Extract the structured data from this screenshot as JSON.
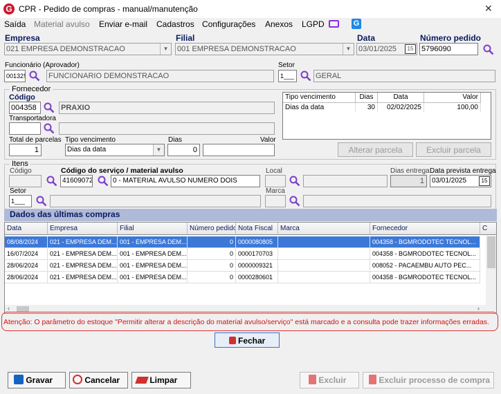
{
  "window": {
    "title": "CPR - Pedido de compras - manual/manutenção",
    "logo": "G"
  },
  "menu": {
    "items": [
      "Saída",
      "Material avulso",
      "Enviar e-mail",
      "Cadastros",
      "Configurações",
      "Anexos",
      "LGPD"
    ]
  },
  "header": {
    "empresa_label": "Empresa",
    "empresa_value": "021 EMPRESA DEMONSTRACAO",
    "filial_label": "Filial",
    "filial_value": "001 EMPRESA DEMONSTRACAO",
    "data_label": "Data",
    "data_value": "03/01/2025",
    "calendar_glyph": "15",
    "numero_label": "Número pedido",
    "numero_value": "5796090",
    "funcionario_label": "Funcionário (Aprovador)",
    "funcionario_code": "00132!",
    "funcionario_name": "FUNCIONARIO DEMONSTRACAO",
    "setor_label": "Setor",
    "setor_code": "1___",
    "setor_name": "GERAL"
  },
  "fornecedor": {
    "group_title": "Fornecedor",
    "codigo_label": "Código",
    "codigo_value": "004358",
    "nome_value": "PRAXIO",
    "transportadora_label": "Transportadora",
    "total_parcelas_label": "Total de parcelas",
    "total_parcelas_value": "1",
    "tipo_venc_label": "Tipo vencimento",
    "tipo_venc_value": "Dias da data",
    "dias_label": "Dias",
    "dias_value": "0",
    "valor_label": "Valor",
    "table": {
      "headers": [
        "Tipo vencimento",
        "Dias",
        "Data",
        "Valor"
      ],
      "row": [
        "Dias da data",
        "30",
        "02/02/2025",
        "100,00"
      ]
    },
    "alterar_parcela": "Alterar parcela",
    "excluir_parcela": "Excluir parcela"
  },
  "itens": {
    "group_title": "Itens",
    "codigo_label": "Código",
    "servico_label": "Código do serviço / material avulso",
    "servico_code": "41609072",
    "servico_desc": "0 - MATERIAL AVULSO NUMERO DOIS",
    "local_label": "Local",
    "dias_entrega_label": "Dias entrega",
    "dias_entrega_value": "1",
    "data_prevista_label": "Data prevista entrega",
    "data_prevista_value": "03/01/2025",
    "setor_label": "Setor",
    "setor_code": "1___",
    "marca_label": "Marca"
  },
  "ultimas": {
    "title": "Dados das últimas compras",
    "headers": [
      "Data",
      "Empresa",
      "Filial",
      "Número pedido",
      "Nota Fiscal",
      "Marca",
      "Fornecedor",
      "C"
    ],
    "rows": [
      [
        "08/08/2024",
        "021 - EMPRESA DEM...",
        "001 - EMPRESA DEM...",
        "0",
        "0000080805",
        "",
        "004358 - BGMRODOTEC TECNOL..."
      ],
      [
        "16/07/2024",
        "021 - EMPRESA DEM...",
        "001 - EMPRESA DEM...",
        "0",
        "0000170703",
        "",
        "004358 - BGMRODOTEC TECNOL..."
      ],
      [
        "28/06/2024",
        "021 - EMPRESA DEM...",
        "001 - EMPRESA DEM...",
        "0",
        "0000009321",
        "",
        "008052 - PACAEMBU AUTO PEC..."
      ],
      [
        "28/06/2024",
        "021 - EMPRESA DEM...",
        "001 - EMPRESA DEM...",
        "0",
        "0000280601",
        "",
        "004358 - BGMRODOTEC TECNOL..."
      ]
    ]
  },
  "warning": "Atenção: O parâmetro do estoque \"Permitir alterar a descrição do material avulso/serviço\" está marcado e a consulta pode trazer informações erradas.",
  "buttons": {
    "fechar": "Fechar",
    "gravar": "Gravar",
    "cancelar": "Cancelar",
    "limpar": "Limpar",
    "excluir": "Excluir",
    "excluir_processo": "Excluir processo de compra"
  },
  "colors": {
    "accent": "#0a1a5c",
    "selection": "#3c78d8",
    "warning": "#d01010",
    "section_header": "#aebad8"
  }
}
